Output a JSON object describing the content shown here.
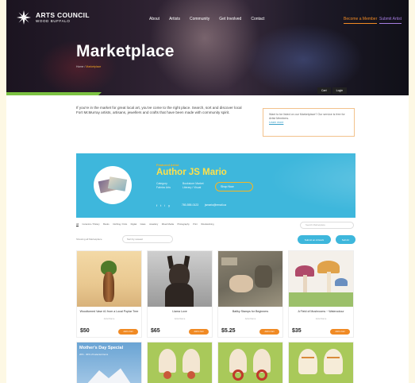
{
  "brand": {
    "name": "ARTS COUNCIL",
    "tagline": "WOOD BUFFALO"
  },
  "nav": [
    "About",
    "Artists",
    "Community",
    "Get Involved",
    "Contact"
  ],
  "cta": {
    "member": "Become a Member",
    "artist": "Submit Artist"
  },
  "hero": {
    "title": "Marketplace",
    "breadcrumb_home": "Home",
    "breadcrumb_sep": "/",
    "breadcrumb_current": "Marketplace",
    "buttons": [
      "Cart",
      "Login"
    ]
  },
  "intro": "If you're in the market for great local art, you've come to the right place. Search, sort and discover local Fort McMurray artists, artisans, jewellers and crafts that have been made with community spirit.",
  "notice": {
    "text": "Want to be listed on our Marketplace? Our service is free for Artist Members.",
    "link": "Learn more"
  },
  "profile": {
    "featured": "Featured Artist",
    "name": "Author JS Mario",
    "meta1": [
      "Category",
      "Fabrics Arts"
    ],
    "meta2": [
      "Bookstore Market",
      "Literary / Visual"
    ],
    "shop_btn": "Shop Now",
    "socials": [
      "f",
      "t",
      "i",
      "y"
    ],
    "contact1": "780-555-0123",
    "contact2": "jsmario@email.ca"
  },
  "categories": [
    "All",
    "Ceramics / Pottery",
    "Books",
    "Clothing / Knits",
    "Digital",
    "Glass",
    "Jewellery",
    "Mixed Media",
    "Photography",
    "Print",
    "Woodworking"
  ],
  "search_placeholder": "Search Marketplace",
  "filter_label": "Showing all Marketplace",
  "sort_label": "Sort by newest",
  "buttons": {
    "submit": "Submit an Artwork",
    "sell": "Sell Art"
  },
  "products": [
    {
      "title": "Woodturned Vase #1 from a Local Poplar Tree",
      "sub": "Artist Name",
      "price": "$50",
      "add": "Add to Cart"
    },
    {
      "title": "Llama Love",
      "sub": "Artist Name",
      "price": "$65",
      "add": "Add to Cart"
    },
    {
      "title": "Batiky Stamps for Beginners",
      "sub": "Artist Name",
      "price": "$5.25",
      "add": "Add to Cart"
    },
    {
      "title": "A Field of Mushrooms ~ Watercolour",
      "sub": "Artist Name",
      "price": "$35",
      "add": "Add to Cart"
    }
  ],
  "promo": {
    "title": "Mother's Day Special",
    "sub": "20% - 30% off selected items"
  },
  "colors": {
    "accent": "#3eb7dc",
    "orange": "#f08a24",
    "gold": "#f5b623",
    "green": "#7cc242"
  }
}
